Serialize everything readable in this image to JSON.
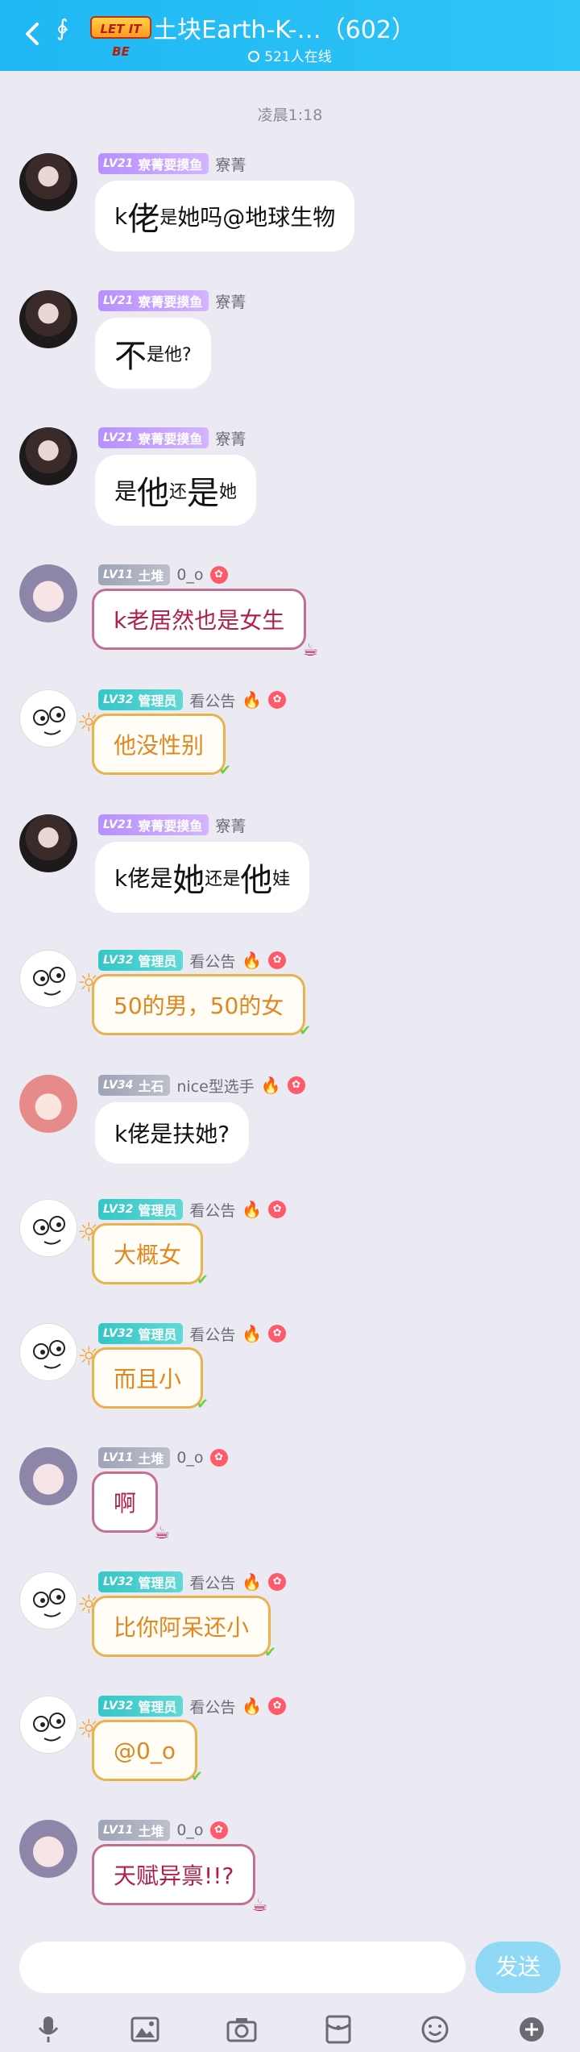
{
  "header": {
    "logo_text": "LET IT BE",
    "title": "土块Earth-K-…（602）",
    "online": "521人在线"
  },
  "timestamp": "凌晨1:18",
  "messages": [
    {
      "level": "LV21",
      "role": "寮菁要摸鱼",
      "nick": "寮菁",
      "parts": [
        {
          "t": "k",
          "c": "n"
        },
        {
          "t": "佬",
          "c": "big"
        },
        {
          "t": "是",
          "c": "small"
        },
        {
          "t": "她吗@地球生物",
          "c": "n"
        }
      ]
    },
    {
      "level": "LV21",
      "role": "寮菁要摸鱼",
      "nick": "寮菁",
      "parts": [
        {
          "t": "不",
          "c": "big"
        },
        {
          "t": "是他?",
          "c": "small"
        }
      ]
    },
    {
      "level": "LV21",
      "role": "寮菁要摸鱼",
      "nick": "寮菁",
      "parts": [
        {
          "t": "是",
          "c": "n"
        },
        {
          "t": "他",
          "c": "big"
        },
        {
          "t": "还",
          "c": "small"
        },
        {
          "t": "是",
          "c": "big"
        },
        {
          "t": "她",
          "c": "small"
        }
      ]
    },
    {
      "level": "LV11",
      "role": "土堆",
      "nick": "0_o",
      "text": "k老居然也是女生"
    },
    {
      "level": "LV32",
      "role": "管理员",
      "nick": "看公告",
      "text": "他没性别"
    },
    {
      "level": "LV21",
      "role": "寮菁要摸鱼",
      "nick": "寮菁",
      "parts": [
        {
          "t": "k佬是",
          "c": "n"
        },
        {
          "t": "她",
          "c": "big"
        },
        {
          "t": "还是",
          "c": "small"
        },
        {
          "t": "他",
          "c": "big"
        },
        {
          "t": "娃",
          "c": "small"
        }
      ]
    },
    {
      "level": "LV32",
      "role": "管理员",
      "nick": "看公告",
      "text": "50的男，50的女"
    },
    {
      "level": "LV34",
      "role": "土石",
      "nick": "nice型选手",
      "text": "k佬是扶她?"
    },
    {
      "level": "LV32",
      "role": "管理员",
      "nick": "看公告",
      "text": "大概女"
    },
    {
      "level": "LV32",
      "role": "管理员",
      "nick": "看公告",
      "text": "而且小"
    },
    {
      "level": "LV11",
      "role": "土堆",
      "nick": "0_o",
      "text": "啊"
    },
    {
      "level": "LV32",
      "role": "管理员",
      "nick": "看公告",
      "text": "比你阿呆还小"
    },
    {
      "level": "LV32",
      "role": "管理员",
      "nick": "看公告",
      "text": "@0_o"
    },
    {
      "level": "LV11",
      "role": "土堆",
      "nick": "0_o",
      "text": "天赋异禀!!?"
    }
  ],
  "input": {
    "placeholder": "",
    "send_label": "发送"
  },
  "toolbar": [
    "mic-icon",
    "image-icon",
    "camera-icon",
    "red-packet-icon",
    "emoji-icon",
    "plus-icon"
  ],
  "colors": {
    "header": "#1fb8f4",
    "background": "#ebeaf2",
    "send": "#8fd9f7"
  }
}
